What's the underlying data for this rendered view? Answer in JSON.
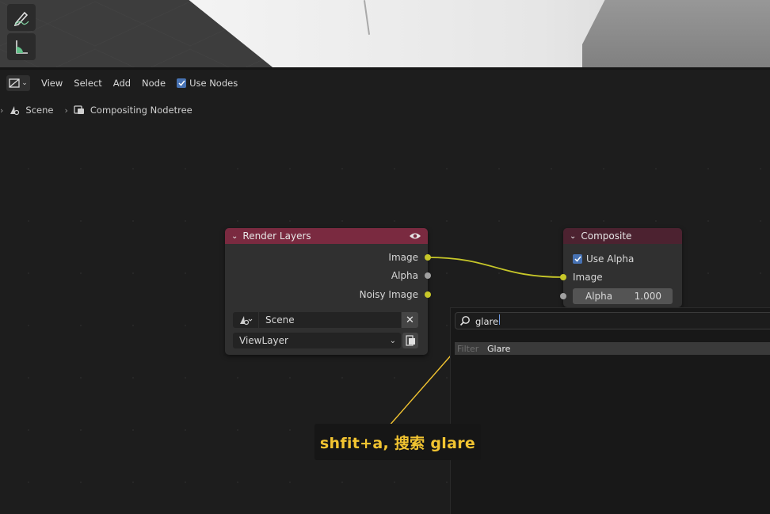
{
  "header": {
    "menus": [
      "View",
      "Select",
      "Add",
      "Node"
    ],
    "use_nodes_label": "Use Nodes"
  },
  "breadcrumb": {
    "scene": "Scene",
    "nodetree": "Compositing Nodetree"
  },
  "render_layers": {
    "title": "Render Layers",
    "outputs": [
      "Image",
      "Alpha",
      "Noisy Image"
    ],
    "scene_value": "Scene",
    "view_layer_value": "ViewLayer"
  },
  "composite": {
    "title": "Composite",
    "use_alpha_label": "Use Alpha",
    "image_input": "Image",
    "alpha_label": "Alpha",
    "alpha_value": "1.000"
  },
  "search": {
    "query": "glare",
    "result_prefix": "Filter",
    "result_name": "Glare"
  },
  "annotation": {
    "text": "shfit+a,  搜索 glare"
  },
  "colors": {
    "render_layers_header": "#7a2a40",
    "composite_header": "#4c2230",
    "socket_color": "#c7c729",
    "annotation_text": "#f2c431",
    "accent_blue": "#4772b3"
  },
  "icons": [
    "annotate-pencil-icon",
    "measure-ruler-icon",
    "editor-type-icon",
    "scene-icon",
    "nodetree-icon",
    "eye-icon",
    "search-icon",
    "clear-x-icon",
    "viewlayer-browse-icon"
  ]
}
